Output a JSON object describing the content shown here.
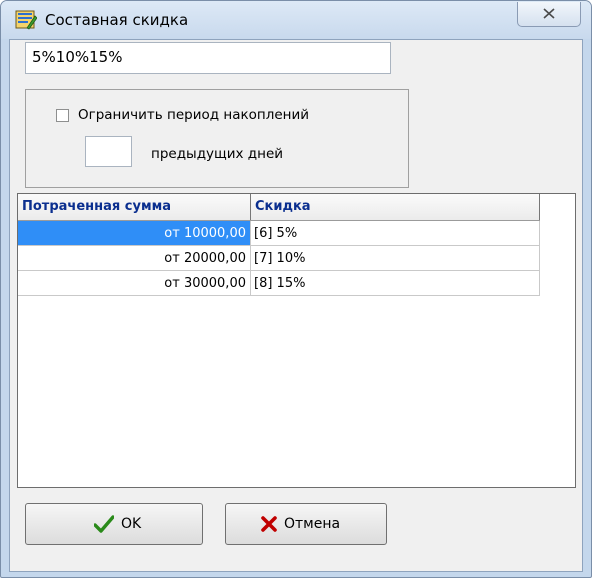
{
  "window": {
    "title": "Составная скидка"
  },
  "formula": {
    "value": "5%10%15%"
  },
  "accumulation": {
    "checkbox_label": "Ограничить период накоплений",
    "checked": false,
    "days_value": "",
    "days_label": "предыдущих дней"
  },
  "grid": {
    "columns": [
      "Потраченная сумма",
      "Скидка"
    ],
    "rows": [
      {
        "sum": "от 10000,00",
        "discount": "[6] 5%",
        "selected": true
      },
      {
        "sum": "от 20000,00",
        "discount": "[7] 10%",
        "selected": false
      },
      {
        "sum": "от 30000,00",
        "discount": "[8] 15%",
        "selected": false
      }
    ]
  },
  "buttons": {
    "ok_label": "OK",
    "cancel_label": "Отмена"
  },
  "colors": {
    "selection": "#2f8ef7",
    "header_text": "#0b2f8f",
    "ok_check": "#2a8a1a",
    "cancel_x": "#c00000"
  },
  "icons": [
    "app-icon",
    "close-icon",
    "checkmark-icon",
    "cross-icon"
  ]
}
